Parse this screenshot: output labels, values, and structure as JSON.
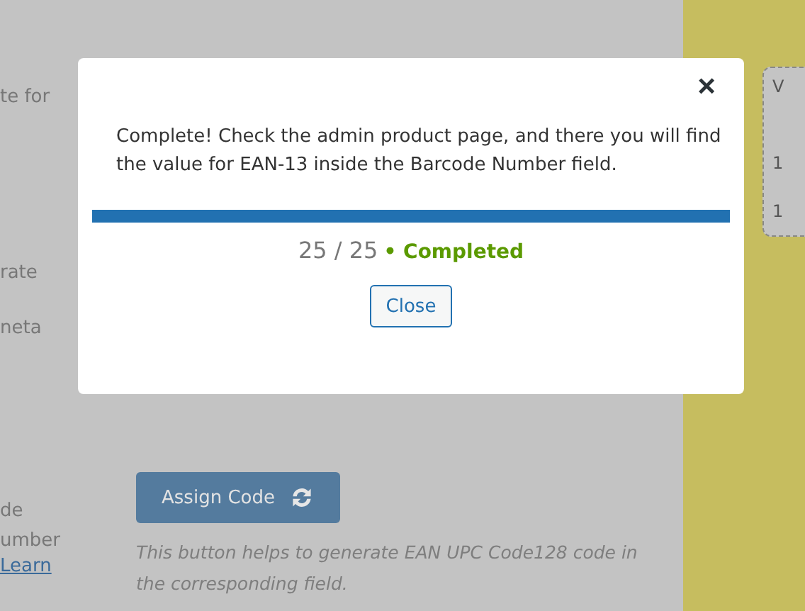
{
  "page": {
    "fragments": [
      {
        "text": "te for"
      },
      {
        "text": "rate"
      },
      {
        "text": "neta"
      },
      {
        "text": "de"
      },
      {
        "text": "umber"
      }
    ],
    "learn_link": "Learn",
    "assign_button": "Assign Code",
    "help_text": "This button helps to generate EAN UPC Code128 code in the corresponding field.",
    "side_card": [
      "V",
      "1",
      "1"
    ]
  },
  "dialog": {
    "close_icon": "×",
    "message": "Complete! Check the admin product page, and there you will find the value for EAN-13 inside the Barcode Number field.",
    "progress": {
      "level": 1.0
    },
    "count": "25 / 25",
    "status": "• Completed",
    "close_button": "Close"
  }
}
